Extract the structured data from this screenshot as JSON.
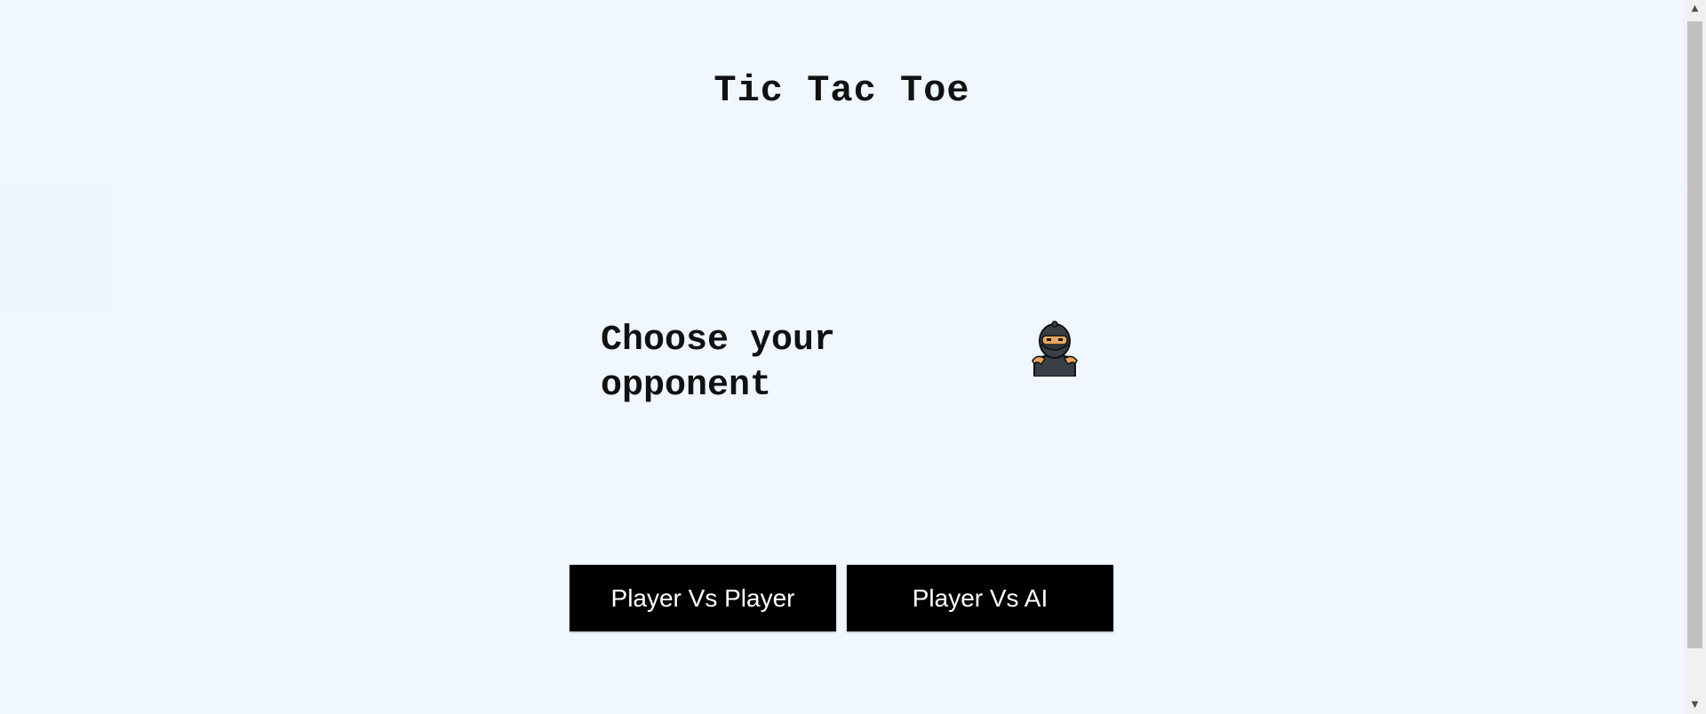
{
  "header": {
    "title": "Tic Tac Toe"
  },
  "prompt": {
    "text": "Choose your opponent",
    "avatar_icon": "ninja-icon"
  },
  "buttons": {
    "pvp_label": "Player Vs Player",
    "pva_label": "Player Vs AI"
  },
  "scrollbar": {
    "up_arrow": "▲",
    "down_arrow": "▼"
  },
  "colors": {
    "background": "#f0f7ff",
    "button_bg": "#000000",
    "button_text": "#ffffff",
    "text": "#111111"
  }
}
